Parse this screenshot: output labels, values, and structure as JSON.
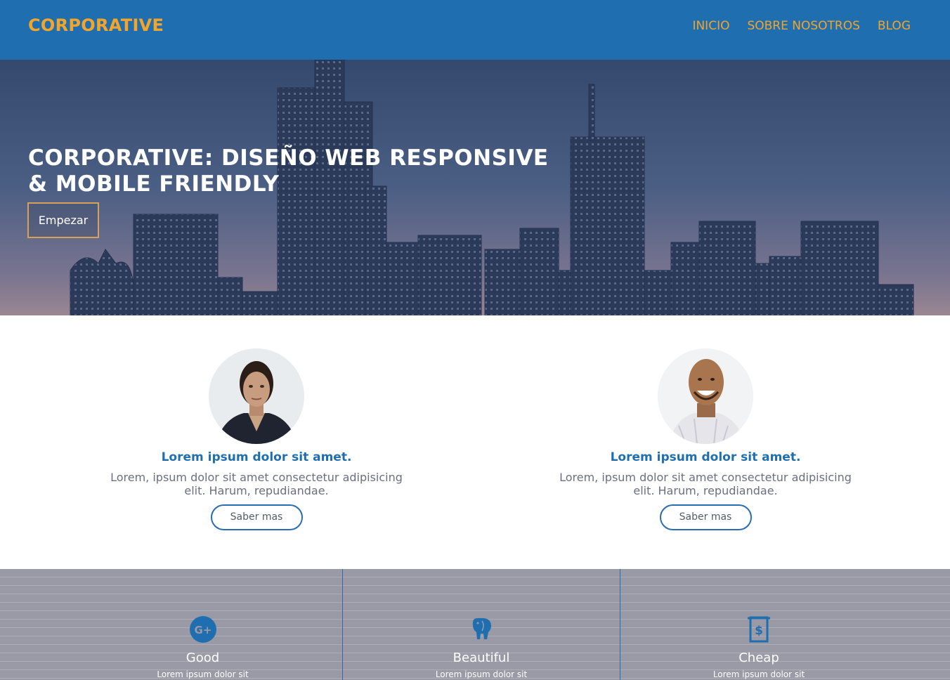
{
  "header": {
    "logo": "CORPORATIVE",
    "nav": [
      "INICIO",
      "SOBRE NOSOTROS",
      "BLOG"
    ]
  },
  "hero": {
    "title": "CORPORATIVE: DISEÑO WEB RESPONSIVE & MOBILE FRIENDLY",
    "button": "Empezar"
  },
  "team": [
    {
      "title": "Lorem ipsum dolor sit amet.",
      "text": "Lorem, ipsum dolor sit amet consectetur adipisicing elit. Harum, repudiandae.",
      "button": "Saber mas"
    },
    {
      "title": "Lorem ipsum dolor sit amet.",
      "text": "Lorem, ipsum dolor sit amet consectetur adipisicing elit. Harum, repudiandae.",
      "button": "Saber mas"
    }
  ],
  "features": [
    {
      "icon": "google-plus-icon",
      "title": "Good",
      "text": "Lorem ipsum dolor sit"
    },
    {
      "icon": "elephant-icon",
      "title": "Beautiful",
      "text": "Lorem ipsum dolor sit"
    },
    {
      "icon": "dollar-receipt-icon",
      "title": "Cheap",
      "text": "Lorem ipsum dolor sit"
    }
  ],
  "colors": {
    "header_bg": "#1f6fb0",
    "accent": "#f3a42b",
    "primary": "#1f6fb0",
    "features_bg": "#9a9aa6"
  }
}
